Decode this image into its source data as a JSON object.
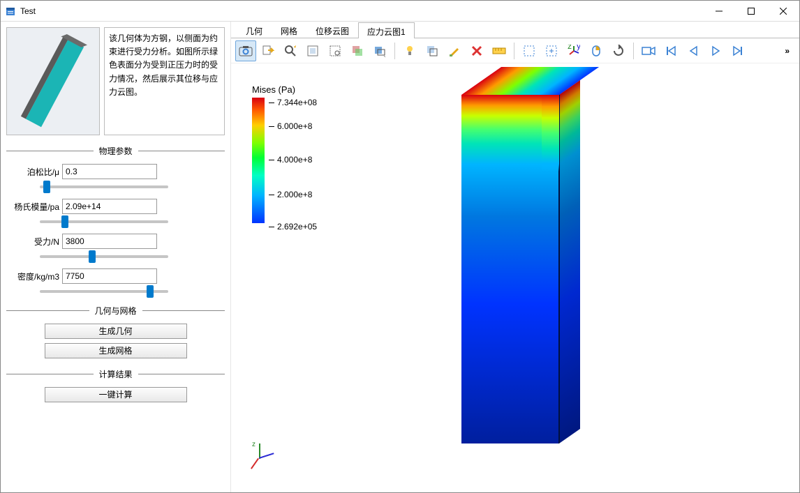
{
  "window": {
    "title": "Test"
  },
  "description": "该几何体为方钢，以侧面为约束进行受力分析。如图所示绿色表面分为受到正压力时的受力情况，然后展示其位移与应力云图。",
  "sections": {
    "physics": "物理参数",
    "geometry": "几何与网格",
    "results": "计算结果"
  },
  "params": {
    "poisson_label": "泊松比/μ",
    "poisson_value": "0.3",
    "young_label": "杨氏模量/pa",
    "young_value": "2.09e+14",
    "force_label": "受力/N",
    "force_value": "3800",
    "density_label": "密度/kg/m3",
    "density_value": "7750"
  },
  "buttons": {
    "gen_geom": "生成几何",
    "gen_mesh": "生成网格",
    "compute": "一键计算"
  },
  "tabs": [
    "几何",
    "网格",
    "位移云图",
    "应力云图1"
  ],
  "active_tab_index": 3,
  "legend": {
    "title": "Mises (Pa)",
    "ticks": [
      "7.344e+08",
      "6.000e+8",
      "4.000e+8",
      "2.000e+8",
      "2.692e+05"
    ]
  },
  "toolbar_overflow": "»",
  "chart_data": {
    "type": "heatmap",
    "title": "Mises (Pa)",
    "colorbar_ticks": [
      269200.0,
      200000000.0,
      400000000.0,
      600000000.0,
      734400000.0
    ],
    "min": 269200.0,
    "max": 734400000.0,
    "colormap": "rainbow"
  }
}
